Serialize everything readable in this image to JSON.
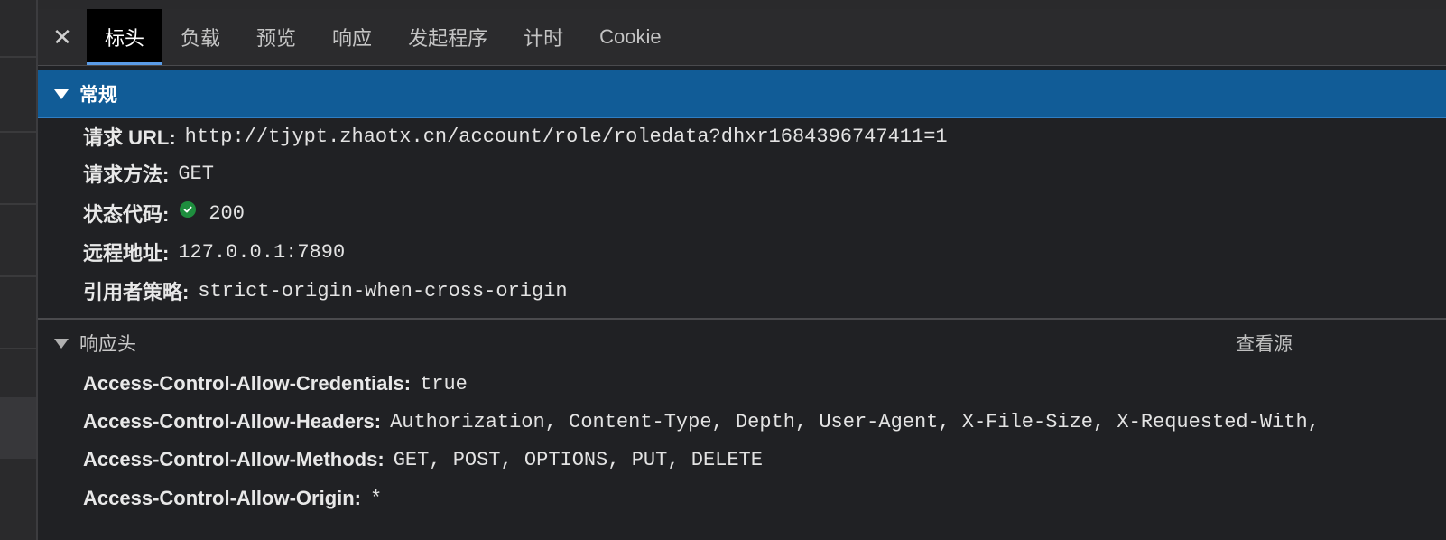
{
  "colors": {
    "accent": "#115c97",
    "active_tab_underline": "#5a9ce8",
    "status_ok": "#1e8e3e",
    "background": "#202124"
  },
  "tabs": [
    {
      "label": "标头",
      "active": true
    },
    {
      "label": "负载",
      "active": false
    },
    {
      "label": "预览",
      "active": false
    },
    {
      "label": "响应",
      "active": false
    },
    {
      "label": "发起程序",
      "active": false
    },
    {
      "label": "计时",
      "active": false
    },
    {
      "label": "Cookie",
      "active": false
    }
  ],
  "general": {
    "title": "常规",
    "rows": [
      {
        "key": "请求 URL:",
        "value": "http://tjypt.zhaotx.cn/account/role/roledata?dhxr1684396747411=1"
      },
      {
        "key": "请求方法:",
        "value": "GET"
      },
      {
        "key": "状态代码:",
        "value": "200",
        "icon": "check-circle-icon"
      },
      {
        "key": "远程地址:",
        "value": "127.0.0.1:7890"
      },
      {
        "key": "引用者策略:",
        "value": "strict-origin-when-cross-origin"
      }
    ]
  },
  "response_headers": {
    "title": "响应头",
    "view_source": "查看源",
    "rows": [
      {
        "key": "Access-Control-Allow-Credentials:",
        "value": "true"
      },
      {
        "key": "Access-Control-Allow-Headers:",
        "value": "Authorization, Content-Type, Depth, User-Agent, X-File-Size, X-Requested-With,"
      },
      {
        "key": "Access-Control-Allow-Methods:",
        "value": "GET, POST, OPTIONS, PUT, DELETE"
      },
      {
        "key": "Access-Control-Allow-Origin:",
        "value": "*"
      }
    ]
  }
}
